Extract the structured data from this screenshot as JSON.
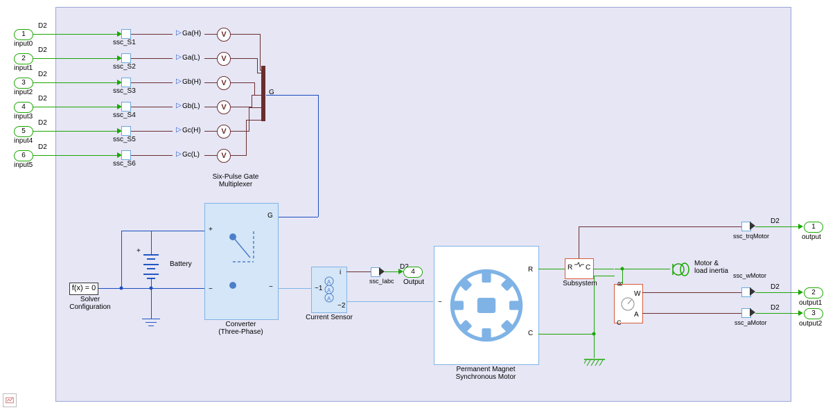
{
  "inputs": [
    {
      "num": "1",
      "name": "input0",
      "tag": "D2",
      "sig": "ssc_S1",
      "gate": "Ga(H)"
    },
    {
      "num": "2",
      "name": "input1",
      "tag": "D2",
      "sig": "ssc_S2",
      "gate": "Ga(L)"
    },
    {
      "num": "3",
      "name": "input2",
      "tag": "D2",
      "sig": "ssc_S3",
      "gate": "Gb(H)"
    },
    {
      "num": "4",
      "name": "input3",
      "tag": "D2",
      "sig": "ssc_S4",
      "gate": "Gb(L)"
    },
    {
      "num": "5",
      "name": "input4",
      "tag": "D2",
      "sig": "ssc_S5",
      "gate": "Gc(H)"
    },
    {
      "num": "6",
      "name": "input5",
      "tag": "D2",
      "sig": "ssc_S6",
      "gate": "Gc(L)"
    }
  ],
  "outputs": [
    {
      "num": "1",
      "name": "output",
      "tag": "D2",
      "sig": "ssc_trqMotor"
    },
    {
      "num": "4",
      "name": "Output",
      "tag": "D2",
      "sig": "ssc_Iabc"
    },
    {
      "num": "2",
      "name": "output1",
      "tag": "D2",
      "sig": "ssc_wMotor"
    },
    {
      "num": "3",
      "name": "output2",
      "tag": "D2",
      "sig": "ssc_aMotor"
    }
  ],
  "blocks": {
    "mux": "Six-Pulse Gate\nMultiplexer",
    "battery": "Battery",
    "solver_cfg": "Solver\nConfiguration",
    "solver_eq": "f(x) = 0",
    "converter": "Converter\n(Three-Phase)",
    "conv_plus": "+",
    "conv_minus": "−",
    "conv_g": "G",
    "conv_t": "~",
    "cs": "Current Sensor",
    "cs_i": "i",
    "cs_1": "~1",
    "cs_2": "~2",
    "pmsm": "Permanent Magnet\nSynchronous Motor",
    "pmsm_t": "~",
    "pmsm_r": "R",
    "pmsm_c": "C",
    "subsys": "Subsystem",
    "subsys_r": "R",
    "subsys_c": "C",
    "inertia": "Motor &\nload inertia",
    "ideal_w": "W",
    "ideal_a": "A",
    "ideal_r": "R",
    "ideal_c": "C",
    "mux_out": "G"
  }
}
